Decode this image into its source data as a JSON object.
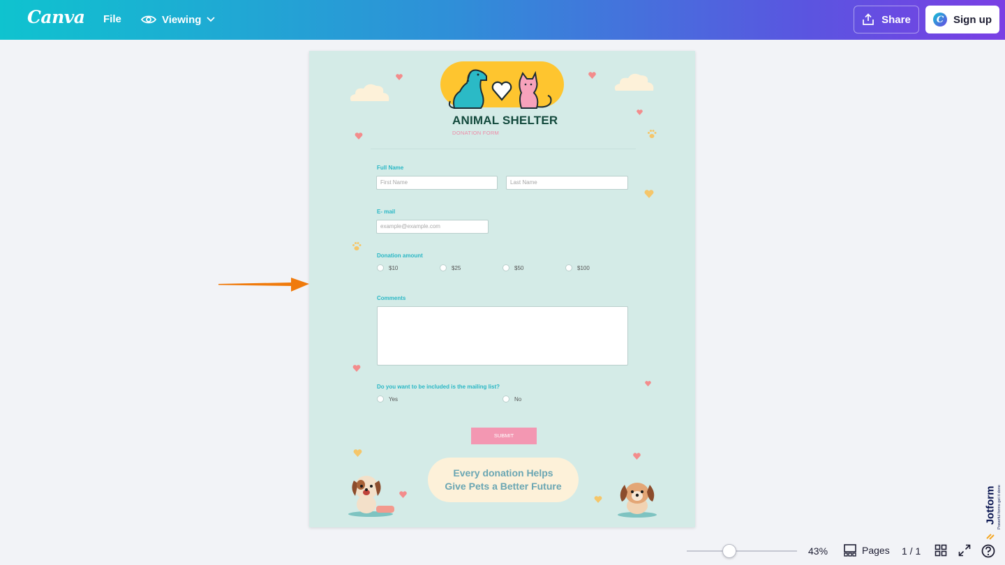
{
  "topbar": {
    "logo": "Canva",
    "file_label": "File",
    "viewing_label": "Viewing",
    "share_label": "Share",
    "signup_label": "Sign up",
    "signup_badge": "C"
  },
  "design": {
    "title": "ANIMAL SHELTER",
    "subtitle": "DONATION FORM",
    "full_name_label": "Full Name",
    "first_name_placeholder": "First Name",
    "last_name_placeholder": "Last Name",
    "email_label": "E- mail",
    "email_placeholder": "example@example.com",
    "donation_label": "Donation amount",
    "donation_options": [
      "$10",
      "$25",
      "$50",
      "$100"
    ],
    "comments_label": "Comments",
    "mailing_label": "Do you want to be included is the mailing list?",
    "mailing_options": [
      "Yes",
      "No"
    ],
    "submit_label": "SUBMIT",
    "bubble_line1": "Every donation Helps",
    "bubble_line2": "Give Pets a Better Future"
  },
  "bottombar": {
    "zoom": "43%",
    "zoom_level": 0.43,
    "pages_label": "Pages",
    "page_count": "1 / 1"
  },
  "watermark": {
    "brand": "Jotform",
    "tagline": "Powerful forms get it done"
  },
  "colors": {
    "accent_teal": "#29b7c5",
    "banner_yellow": "#fec52f",
    "submit_pink": "#f397b2",
    "arrow_orange": "#f07a0c",
    "page_bg": "#d4ebe7"
  },
  "icons": [
    "eye-icon",
    "chevron-down-icon",
    "share-upload-icon",
    "pages-icon",
    "grid-view-icon",
    "fullscreen-icon",
    "help-icon",
    "arrow-pointer-icon"
  ]
}
